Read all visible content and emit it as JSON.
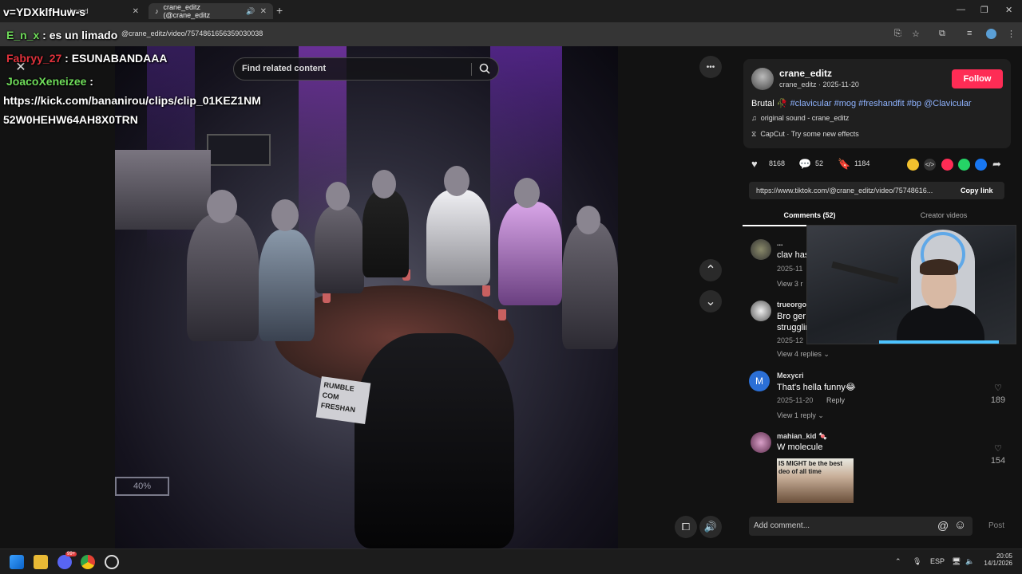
{
  "browser": {
    "tab1_title": "...board",
    "tab2_title": "crane_editz (@crane_editz",
    "new_tab": "+",
    "url": "@crane_editz/video/7574861656359030038",
    "win_min": "—",
    "win_max": "❐",
    "win_close": "✕"
  },
  "chat": {
    "line0": "v=YDXklfHuw-s",
    "line1_user": "E_n_x",
    "line1_msg": ": es un limado",
    "line2_user": "Fabryy_27",
    "line2_msg": ": ESUNABANDAAA",
    "line3_user": "JoacoXeneizee",
    "line3_msg": ":",
    "line4": "https://kick.com/bananirou/clips/clip_01KEZ1NM",
    "line5": "52W0HEHW64AH8X0TRN",
    "colors": {
      "user1": "#6fdc5a",
      "user2": "#e0323c",
      "user3": "#6fdc5a"
    }
  },
  "search": {
    "placeholder": "Find related content"
  },
  "video": {
    "sign_text": "RUMBLE\nCOM\nFRESHAN",
    "percent_label": "40%",
    "close_icon": "✕",
    "more_icon": "•••",
    "up_icon": "⌃",
    "down_icon": "⌄"
  },
  "post": {
    "author": "crane_editz",
    "author_sub": "crane_editz · 2025-11-20",
    "follow_label": "Follow",
    "caption_lead": "Brutal 🥀",
    "hashtags": "#clavicular #mog #freshandfit #bp @Clavicular",
    "sound": "original sound - crane_editz",
    "capcut": "CapCut · Try some new effects",
    "likes": "8168",
    "comments_count": "52",
    "saves": "1184",
    "link": "https://www.tiktok.com/@crane_editz/video/75748616...",
    "copy_link_label": "Copy link",
    "tab_comments": "Comments (52)",
    "tab_creator": "Creator videos"
  },
  "comments": [
    {
      "name": "...",
      "text": "clav has",
      "meta": "2025-11",
      "view": "View 3 r"
    },
    {
      "name": "trueorgo",
      "text": "Bro ger",
      "text2": "strugglin",
      "meta": "2025-12",
      "view": "View 4 replies ⌄"
    },
    {
      "name": "Mexycri",
      "text": "That's hella funny😂",
      "meta": "2025-11-20",
      "reply": "Reply",
      "view": "View 1 reply ⌄",
      "likes": "189",
      "avatar_letter": "M"
    },
    {
      "name": "mahian_kid 🍬",
      "text": "W molecule",
      "likes": "154",
      "meme_text": "IS MIGHT be the best\ndeo of all time"
    }
  ],
  "add_comment": {
    "placeholder": "Add comment...",
    "post_label": "Post",
    "at_icon": "@",
    "emoji_icon": "☺"
  },
  "taskbar": {
    "lang": "ESP",
    "time": "20:05",
    "date": "14/1/2026",
    "badge": "99+"
  },
  "colors": {
    "accent": "#fe2c55",
    "hashtag": "#8fb3ff"
  }
}
